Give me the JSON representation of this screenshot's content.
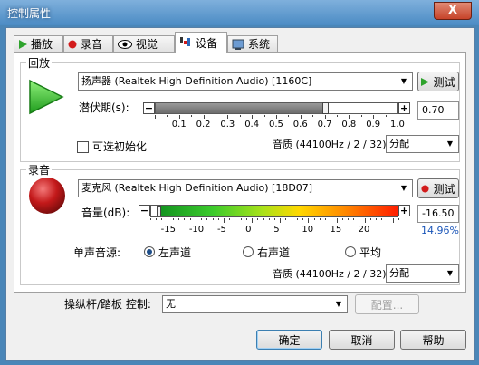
{
  "window": {
    "title": "控制属性",
    "close": "X"
  },
  "tabs": [
    {
      "label": "播放",
      "icon": "play-icon"
    },
    {
      "label": "录音",
      "icon": "record-icon"
    },
    {
      "label": "视觉",
      "icon": "eye-icon"
    },
    {
      "label": "设备",
      "icon": "device-icon"
    },
    {
      "label": "系统",
      "icon": "system-icon"
    }
  ],
  "active_tab": "设备",
  "playback": {
    "group_label": "回放",
    "device": "扬声器 (Realtek High Definition Audio) [1160C]",
    "test_label": "测试",
    "latency_label": "潜伏期(s):",
    "latency_value": "0.70",
    "latency_level": 0.7,
    "latency_ticks": [
      "0.1",
      "0.2",
      "0.3",
      "0.4",
      "0.5",
      "0.6",
      "0.7",
      "0.8",
      "0.9",
      "1.0"
    ],
    "optional_init_label": "可选初始化",
    "optional_init_checked": false,
    "quality_label": "音质 (44100Hz / 2 / 32):",
    "quality_value": "分配"
  },
  "recording": {
    "group_label": "录音",
    "device": "麦克风 (Realtek High Definition Audio) [18D07]",
    "test_label": "测试",
    "volume_label": "音量(dB):",
    "volume_value": "-16.50",
    "volume_percent": "14.96%",
    "volume_ticks": [
      "-15",
      "-10",
      "-5",
      "0",
      "5",
      "10",
      "15",
      "20"
    ],
    "mono_source_label": "单声音源:",
    "mono_options": [
      "左声道",
      "右声道",
      "平均"
    ],
    "mono_selected": "左声道",
    "quality_label": "音质 (44100Hz / 2 / 32):",
    "quality_value": "分配"
  },
  "joystick": {
    "label": "操纵杆/踏板 控制:",
    "value": "无",
    "configure_label": "配置..."
  },
  "buttons": {
    "ok": "确定",
    "cancel": "取消",
    "help": "帮助"
  },
  "colors": {
    "play_green": "#27c425",
    "record_red": "#c3191a",
    "title_blue": "#4b8bc4"
  }
}
